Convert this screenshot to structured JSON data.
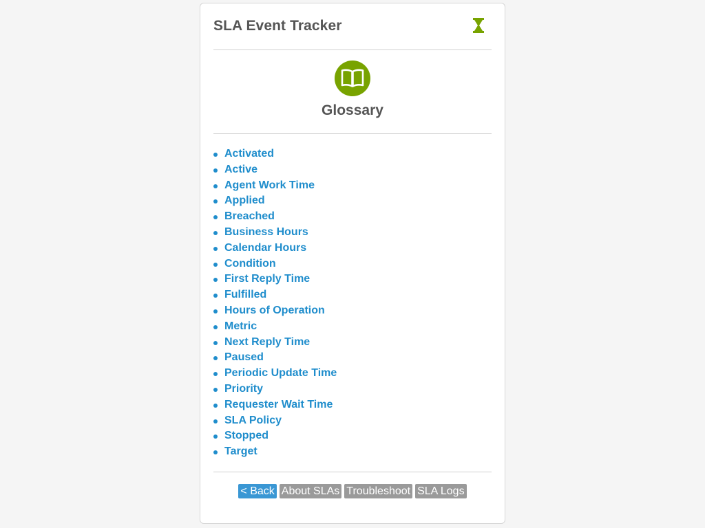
{
  "app": {
    "title": "SLA Event Tracker",
    "icon": "hourglass-icon"
  },
  "hero": {
    "icon": "book-icon",
    "title": "Glossary"
  },
  "glossary_terms": [
    "Activated",
    "Active",
    "Agent Work Time",
    "Applied",
    "Breached",
    "Business Hours",
    "Calendar Hours",
    "Condition",
    "First Reply Time",
    "Fulfilled",
    "Hours of Operation",
    "Metric",
    "Next Reply Time",
    "Paused",
    "Periodic Update Time",
    "Priority",
    "Requester Wait Time",
    "SLA Policy",
    "Stopped",
    "Target"
  ],
  "nav": {
    "back": "< Back",
    "about": "About SLAs",
    "troubleshoot": "Troubleshoot",
    "logs": "SLA Logs"
  },
  "colors": {
    "brand_green": "#78a300",
    "link_blue": "#1f8dcc",
    "back_button": "#3a97d4",
    "nav_button": "#9a9a9a",
    "title_text": "#555555"
  }
}
